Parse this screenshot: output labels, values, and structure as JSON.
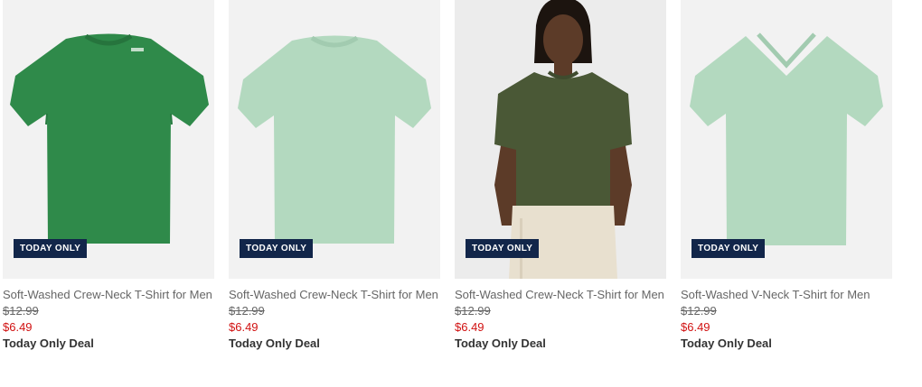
{
  "products": [
    {
      "title": "Soft-Washed Crew-Neck T-Shirt for Men",
      "badge": "TODAY ONLY",
      "original_price": "$12.99",
      "sale_price": "$6.49",
      "deal_text": "Today Only Deal",
      "image_type": "flat-lay-crew-neck-tshirt",
      "shirt_color": "#2f8a4a"
    },
    {
      "title": "Soft-Washed Crew-Neck T-Shirt for Men",
      "badge": "TODAY ONLY",
      "original_price": "$12.99",
      "sale_price": "$6.49",
      "deal_text": "Today Only Deal",
      "image_type": "flat-lay-crew-neck-tshirt",
      "shirt_color": "#b3d9bf"
    },
    {
      "title": "Soft-Washed Crew-Neck T-Shirt for Men",
      "badge": "TODAY ONLY",
      "original_price": "$12.99",
      "sale_price": "$6.49",
      "deal_text": "Today Only Deal",
      "image_type": "model-wearing-tshirt",
      "shirt_color": "#4a5836"
    },
    {
      "title": "Soft-Washed V-Neck T-Shirt for Men",
      "badge": "TODAY ONLY",
      "original_price": "$12.99",
      "sale_price": "$6.49",
      "deal_text": "Today Only Deal",
      "image_type": "flat-lay-v-neck-tshirt",
      "shirt_color": "#b3d9bf"
    }
  ],
  "colors": {
    "badge_bg": "#12264a",
    "sale_price": "#d11111",
    "title_text": "#666666",
    "deal_text": "#333333"
  }
}
